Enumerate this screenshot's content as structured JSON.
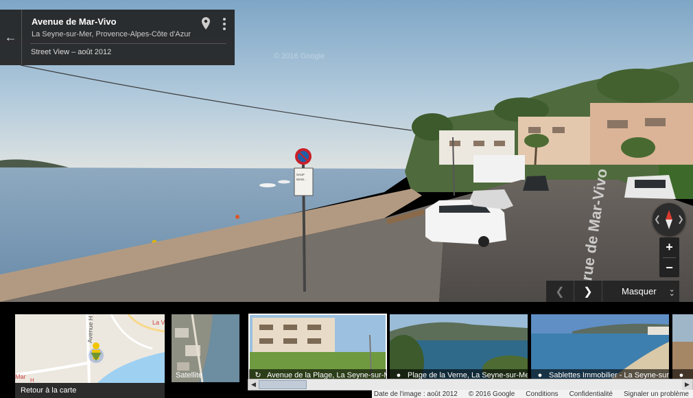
{
  "info_card": {
    "back_icon": "arrow-left-icon",
    "title": "Avenue de Mar-Vivo",
    "subtitle": "La Seyne-sur-Mer, Provence-Alpes-Côte d'Azur",
    "street_view_date": "Street View – août 2012",
    "pin_icon": "map-pin-icon",
    "more_icon": "more-vert-icon"
  },
  "panorama": {
    "watermark": "© 2016 Google",
    "sign_text": "SAUF\nMAIS...",
    "road_marking": "rue de Mar-Vivo"
  },
  "controls": {
    "compass_icon": "compass-icon",
    "zoom_in": "+",
    "zoom_out": "−",
    "prev_icon": "chevron-left-icon",
    "next_icon": "chevron-right-icon",
    "hide_label": "Masquer",
    "hide_icon": "double-chevron-down-icon"
  },
  "filmstrip": {
    "map_tile": {
      "caption": "Retour à la carte",
      "labels": [
        "Avenue H",
        "La V",
        "Mar",
        "H"
      ]
    },
    "satellite_label": "Satellite",
    "photos": [
      {
        "label": "Avenue de la Plage, La Seyne-sur-Mer",
        "icon": "street-view-360-icon"
      },
      {
        "label": "Plage de la Verne, La Seyne-sur-Mer",
        "icon": "camera-icon"
      },
      {
        "label": "Sablettes Immobilier - La Seyne-sur-Mer",
        "icon": "camera-icon"
      },
      {
        "label": "",
        "icon": "camera-icon"
      }
    ]
  },
  "footer": {
    "image_date": "Date de l'image : août 2012",
    "copyright": "© 2016 Google",
    "terms": "Conditions",
    "privacy": "Confidentialité",
    "report": "Signaler un problème"
  },
  "colors": {
    "sky_top": "#7ea6c6",
    "sea": "#7f9db8",
    "wall": "#b29a82",
    "road": "#5c5754",
    "panel_bg": "#222222"
  }
}
